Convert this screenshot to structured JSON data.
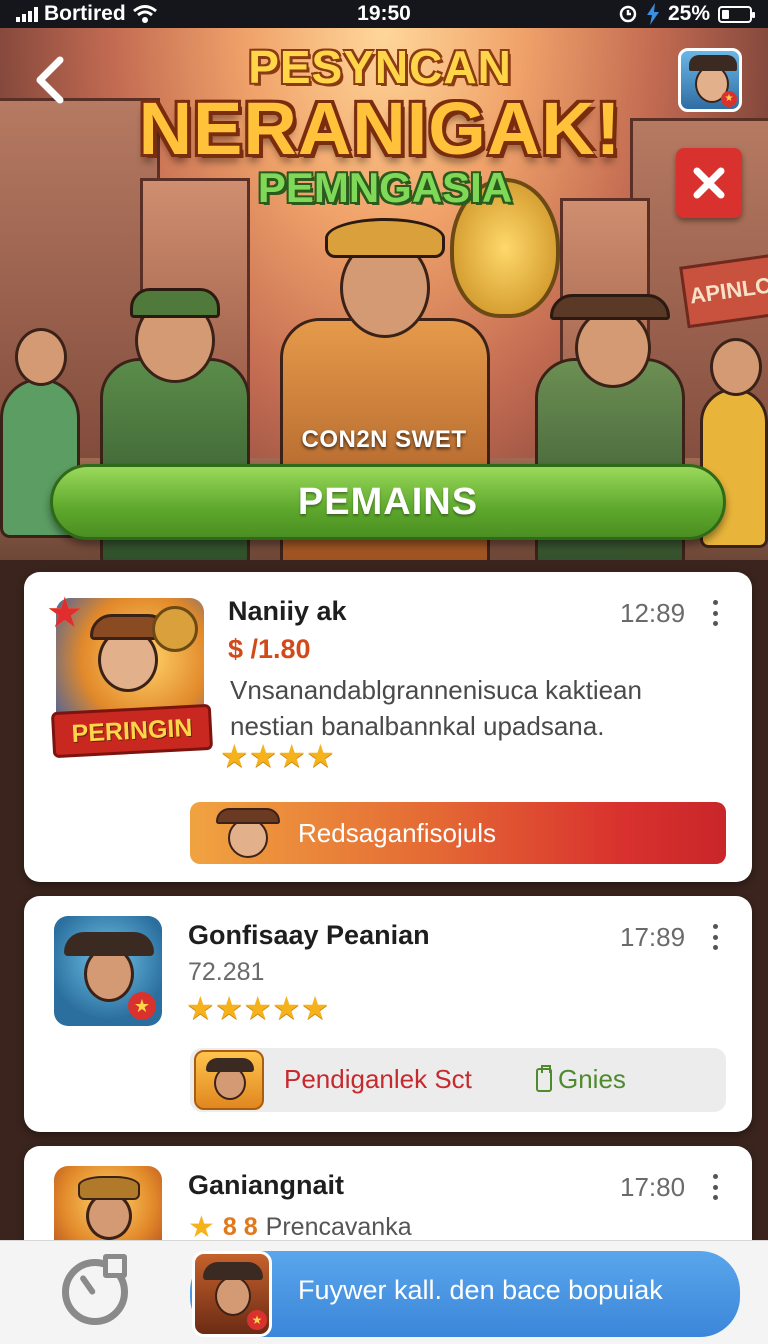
{
  "status_bar": {
    "carrier": "Bortired",
    "time": "19:50",
    "battery_percent_label": "25%",
    "battery_level": 0.25
  },
  "hero": {
    "title_line1": "PESYNCAN",
    "title_line2": "NERANIGAK!",
    "title_line3": "PEMNGASIA",
    "caption": "CON2N SWET",
    "primary_button": "PEMAINS",
    "sign_text": "APINLC"
  },
  "cards": [
    {
      "title": "Naniiy ak",
      "time": "12:89",
      "price": "$ /1.80",
      "description": "Vnsanandablgrannenisuca kaktiean nestian banalbannkal upadsana.",
      "thumb_ribbon": "PERINGIN",
      "stars": "★★★★",
      "rating": 4,
      "banner_label": "Redsaganfisojuls"
    },
    {
      "title": "Gonfisaay Peanian",
      "time": "17:89",
      "meta": "72.281",
      "stars": "★★★★★",
      "rating": 5,
      "action_left": "Pendiganlek Sct",
      "action_right": "Gnies"
    },
    {
      "title": "Ganiangnait",
      "time": "17:80",
      "rating_value": "8 8",
      "meta_text": "Prencavanka"
    }
  ],
  "bottom_bar": {
    "cta_label": "Fuywer kall. den bace bopuiak"
  },
  "colors": {
    "primary_green": "#5da82c",
    "accent_red": "#d9322e",
    "cta_blue": "#3b86d9",
    "star_gold": "#f6b21b"
  },
  "icons": [
    "wifi-icon",
    "back-arrow-icon",
    "close-icon",
    "more-vert-icon",
    "star-icon",
    "clipboard-icon",
    "timer-icon"
  ]
}
